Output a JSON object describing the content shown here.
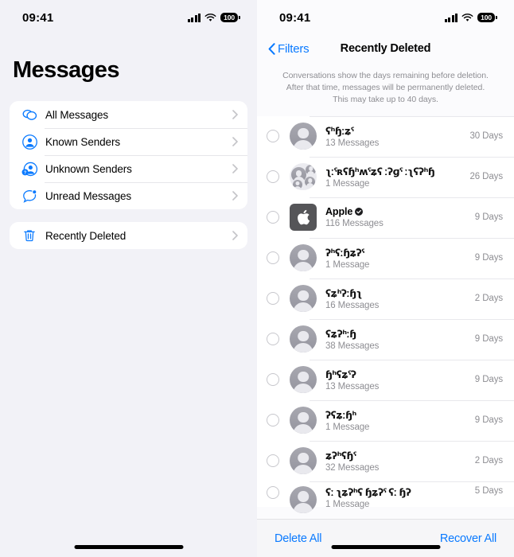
{
  "status_bar": {
    "time": "09:41",
    "signal_icon": "cellular-signal-icon",
    "wifi_icon": "wifi-icon",
    "battery_level": "100"
  },
  "left_pane": {
    "title": "Messages",
    "groups": [
      {
        "items": [
          {
            "label": "All Messages",
            "icon": "chat-bubbles-icon"
          },
          {
            "label": "Known Senders",
            "icon": "person-circle-icon"
          },
          {
            "label": "Unknown Senders",
            "icon": "person-question-icon"
          },
          {
            "label": "Unread Messages",
            "icon": "chat-bubble-dot-icon"
          }
        ]
      },
      {
        "items": [
          {
            "label": "Recently Deleted",
            "icon": "trash-icon"
          }
        ]
      }
    ]
  },
  "right_pane": {
    "back_label": "Filters",
    "title": "Recently Deleted",
    "description": "Conversations show the days remaining before deletion. After that time, messages will be permanently deleted. This may take up to 40 days.",
    "conversations": [
      {
        "name": "ʕʰɧːʑˤ",
        "redacted": true,
        "avatar": "person-avatar",
        "verified": false,
        "count": "13 Messages",
        "days": "30 Days"
      },
      {
        "name": "ʅːˤʀʕɧʰʍˤʑʕ ːʔɡˤ ːʅʕʔʰɧ",
        "redacted": true,
        "avatar": "group-avatar",
        "verified": false,
        "count": "1 Message",
        "days": "26 Days"
      },
      {
        "name": "Apple",
        "redacted": false,
        "avatar": "apple-logo-avatar",
        "verified": true,
        "count": "116 Messages",
        "days": "9 Days"
      },
      {
        "name": "ʔʰʕːɧʑʔˤ",
        "redacted": true,
        "avatar": "person-avatar",
        "verified": false,
        "count": "1 Message",
        "days": "9 Days"
      },
      {
        "name": "ʕʑʰʔːɧʅ",
        "redacted": true,
        "avatar": "person-avatar",
        "verified": false,
        "count": "16 Messages",
        "days": "2 Days"
      },
      {
        "name": "ʕʑʔʰːɧ",
        "redacted": true,
        "avatar": "person-avatar",
        "verified": false,
        "count": "38 Messages",
        "days": "9 Days"
      },
      {
        "name": "ɧʰʕʑˤʔ",
        "redacted": true,
        "avatar": "person-avatar",
        "verified": false,
        "count": "13 Messages",
        "days": "9 Days"
      },
      {
        "name": "ʔʕʑːɧʰ",
        "redacted": true,
        "avatar": "person-avatar",
        "verified": false,
        "count": "1 Message",
        "days": "9 Days"
      },
      {
        "name": "ʑʔʰʕɧˤ",
        "redacted": true,
        "avatar": "person-avatar",
        "verified": false,
        "count": "32 Messages",
        "days": "2 Days"
      },
      {
        "name": "ʕː ʅʑʔʰʕ ɧʑʔˤ ʕː ɧʔ",
        "redacted": true,
        "avatar": "person-avatar",
        "verified": false,
        "count": "1 Message",
        "days": "5 Days"
      }
    ],
    "toolbar": {
      "delete_all_label": "Delete All",
      "recover_all_label": "Recover All"
    }
  },
  "colors": {
    "accent_blue": "#0a7aff",
    "pane_left_bg": "#f2f2f7",
    "secondary_text": "#8e8e93"
  }
}
